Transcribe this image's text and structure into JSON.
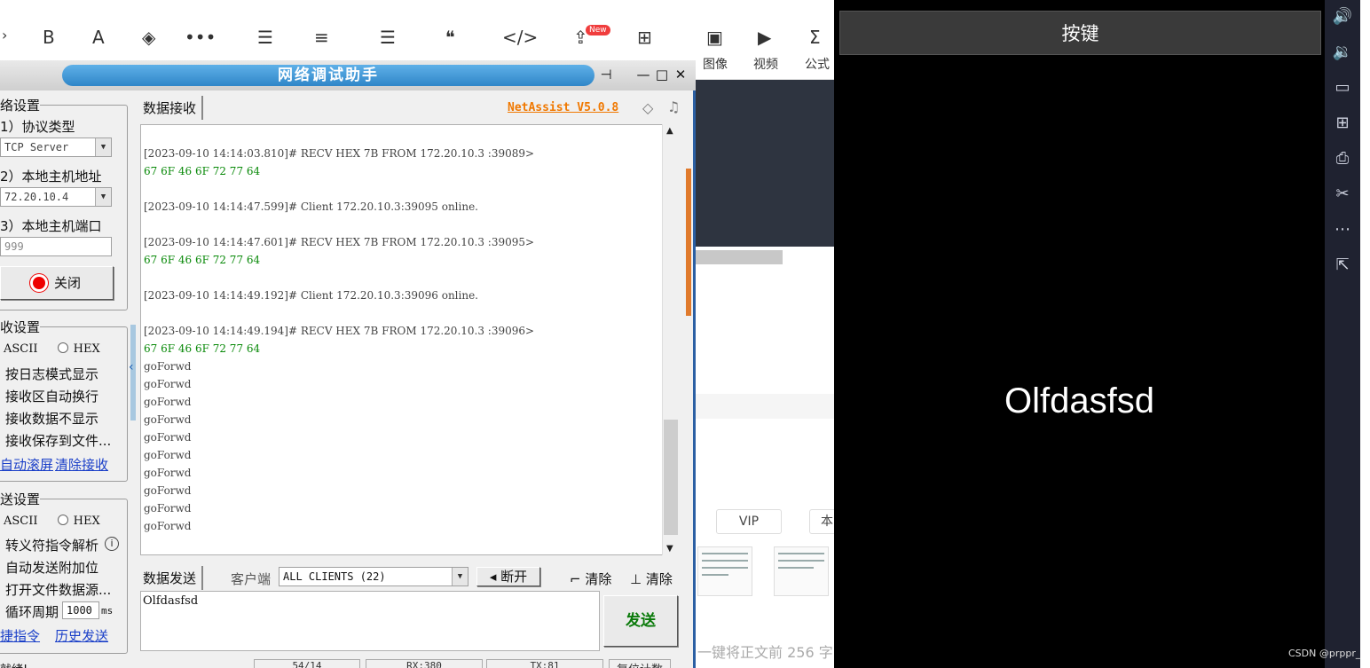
{
  "toolbar": {
    "icons": [
      {
        "name": "bold-icon",
        "glyph": "B"
      },
      {
        "name": "text-color-icon",
        "glyph": "A"
      },
      {
        "name": "highlight-icon",
        "glyph": "◈"
      },
      {
        "name": "more-icon",
        "glyph": "•••"
      },
      {
        "name": "unordered-list-icon",
        "glyph": "☰"
      },
      {
        "name": "align-icon",
        "glyph": "≡"
      },
      {
        "name": "divider-icon",
        "glyph": "☰"
      },
      {
        "name": "quote-icon",
        "glyph": "❝"
      },
      {
        "name": "code-icon",
        "glyph": "</>"
      },
      {
        "name": "upload-icon",
        "glyph": "⇪"
      },
      {
        "name": "table-icon",
        "glyph": "⊞"
      },
      {
        "name": "image-icon",
        "glyph": "▣"
      },
      {
        "name": "video-icon",
        "glyph": "▶"
      },
      {
        "name": "formula-icon",
        "glyph": "Σ"
      }
    ],
    "new_badge": "New",
    "labels": {
      "image": "图像",
      "video": "视频",
      "formula": "公式"
    },
    "pills": {
      "vip": "VIP",
      "other": "本"
    },
    "bottom_hint": "一键将正文前 256 字"
  },
  "netassist": {
    "title": "网络调试助手",
    "window_btns": {
      "pin": "⊣",
      "min": "—",
      "max": "□",
      "close": "✕"
    },
    "net_group": "络设置",
    "protocol_label": "1）协议类型",
    "protocol_value": "TCP Server",
    "host_label": "2）本地主机地址",
    "host_value": "72.20.10.4",
    "port_label": "3）本地主机端口",
    "port_value": "999",
    "close_btn": "关闭",
    "recv_group": "收设置",
    "recv_ascii": "ASCII",
    "recv_hex": "HEX",
    "recv_opts": [
      "按日志模式显示",
      "接收区自动换行",
      "接收数据不显示",
      "接收保存到文件..."
    ],
    "recv_links": [
      "自动滚屏",
      "清除接收"
    ],
    "send_group": "送设置",
    "send_ascii": "ASCII",
    "send_hex": "HEX",
    "send_opts": [
      "转义符指令解析",
      "自动发送附加位",
      "打开文件数据源...",
      "循环周期"
    ],
    "cycle_value": "1000",
    "cycle_unit": "ms",
    "send_links": [
      "捷指令",
      "历史发送"
    ],
    "recv_tab": "数据接收",
    "version": "NetAssist V5.0.8",
    "log": [
      {
        "t": "[2023-09-10 14:14:03.810]# RECV HEX 7B FROM 172.20.10.3 :39089>",
        "c": "n"
      },
      {
        "t": "67 6F 46 6F 72 77 64",
        "c": "g"
      },
      {
        "t": "",
        "c": "b"
      },
      {
        "t": "[2023-09-10 14:14:47.599]# Client 172.20.10.3:39095 online.",
        "c": "n"
      },
      {
        "t": "",
        "c": "b"
      },
      {
        "t": "[2023-09-10 14:14:47.601]# RECV HEX 7B FROM 172.20.10.3 :39095>",
        "c": "n"
      },
      {
        "t": "67 6F 46 6F 72 77 64",
        "c": "g"
      },
      {
        "t": "",
        "c": "b"
      },
      {
        "t": "[2023-09-10 14:14:49.192]# Client 172.20.10.3:39096 online.",
        "c": "n"
      },
      {
        "t": "",
        "c": "b"
      },
      {
        "t": "[2023-09-10 14:14:49.194]# RECV HEX 7B FROM 172.20.10.3 :39096>",
        "c": "n"
      },
      {
        "t": "67 6F 46 6F 72 77 64",
        "c": "g"
      },
      {
        "t": "goForwd",
        "c": "n"
      },
      {
        "t": "goForwd",
        "c": "n"
      },
      {
        "t": "goForwd",
        "c": "n"
      },
      {
        "t": "goForwd",
        "c": "n"
      },
      {
        "t": "goForwd",
        "c": "n"
      },
      {
        "t": "goForwd",
        "c": "n"
      },
      {
        "t": "goForwd",
        "c": "n"
      },
      {
        "t": "goForwd",
        "c": "n"
      },
      {
        "t": "goForwd",
        "c": "n"
      },
      {
        "t": "goForwd",
        "c": "n"
      }
    ],
    "send_tab": "数据发送",
    "client_label": "客户端",
    "client_value": "ALL CLIENTS (22)",
    "disconnect_btn": "断开",
    "clear1": "清除",
    "clear2": "清除",
    "send_text": "Olfdasfsd",
    "send_btn": "发送",
    "status": {
      "left": "就绪!",
      "s1": "54/14",
      "rx": "RX:380",
      "tx": "TX:81",
      "reset": "复位计数"
    }
  },
  "phone": {
    "button": "按键",
    "text": "Olfdasfsd",
    "side_icons": [
      {
        "name": "volume-up-icon",
        "glyph": "🔊"
      },
      {
        "name": "volume-down-icon",
        "glyph": "🔉"
      },
      {
        "name": "screen-icon",
        "glyph": "▭"
      },
      {
        "name": "apk-install-icon",
        "glyph": "⊞"
      },
      {
        "name": "print-icon",
        "glyph": "⎙"
      },
      {
        "name": "scissors-icon",
        "glyph": "✂"
      },
      {
        "name": "more-icon",
        "glyph": "⋯"
      },
      {
        "name": "external-link-icon",
        "glyph": "⇱"
      }
    ],
    "watermark": "CSDN @prppr_"
  }
}
